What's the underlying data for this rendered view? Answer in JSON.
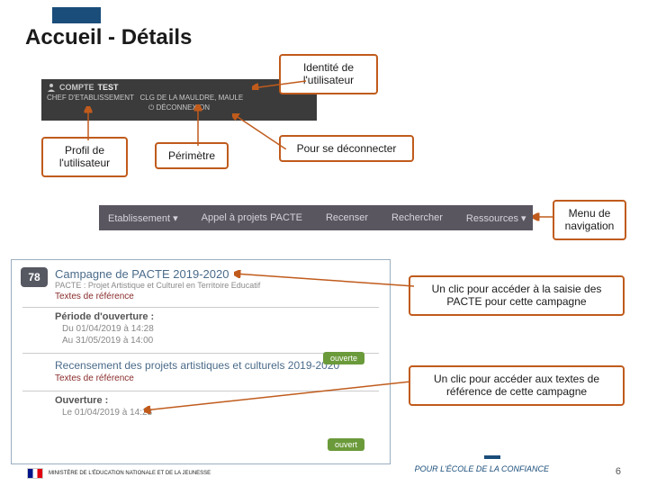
{
  "title": "Accueil - Détails",
  "callouts": {
    "identite": "Identité de l'utilisateur",
    "profil": "Profil de l'utilisateur",
    "perimetre": "Périmètre",
    "deconnecter": "Pour se déconnecter",
    "menu": "Menu de navigation",
    "clic_saisie": "Un clic pour accéder à la saisie des PACTE pour cette campagne",
    "clic_textes": "Un clic pour accéder aux textes de référence de cette campagne"
  },
  "user_bar": {
    "account_label": "COMPTE",
    "account_value": "TEST",
    "role": "CHEF D'ETABLISSEMENT",
    "scope": "CLG DE LA MAULDRE, MAULE",
    "logout": "DÉCONNEXION"
  },
  "nav": {
    "items": [
      {
        "label": "Etablissement ▾"
      },
      {
        "label": "Appel à projets PACTE"
      },
      {
        "label": "Recenser"
      },
      {
        "label": "Rechercher"
      },
      {
        "label": "Ressources ▾"
      }
    ]
  },
  "card": {
    "dept": "78",
    "campaign_title": "Campagne de PACTE 2019-2020",
    "campaign_sub": "PACTE : Projet Artistique et Culturel en Territoire Educatif",
    "ref_link": "Textes de référence",
    "period_label": "Période d'ouverture :",
    "period_from": "Du 01/04/2019 à 14:28",
    "period_to": "Au 31/05/2019 à 14:00",
    "status1": "ouverte",
    "recensement_title": "Recensement des projets artistiques et culturels 2019-2020",
    "ref_link2": "Textes de référence",
    "open_label": "Ouverture :",
    "open_date": "Le 01/04/2019 à 14:28",
    "status2": "ouvert"
  },
  "footer": {
    "ministry": "MINISTÈRE DE L'ÉDUCATION NATIONALE ET DE LA JEUNESSE",
    "right": "POUR L'ÉCOLE DE LA CONFIANCE",
    "page": "6"
  }
}
